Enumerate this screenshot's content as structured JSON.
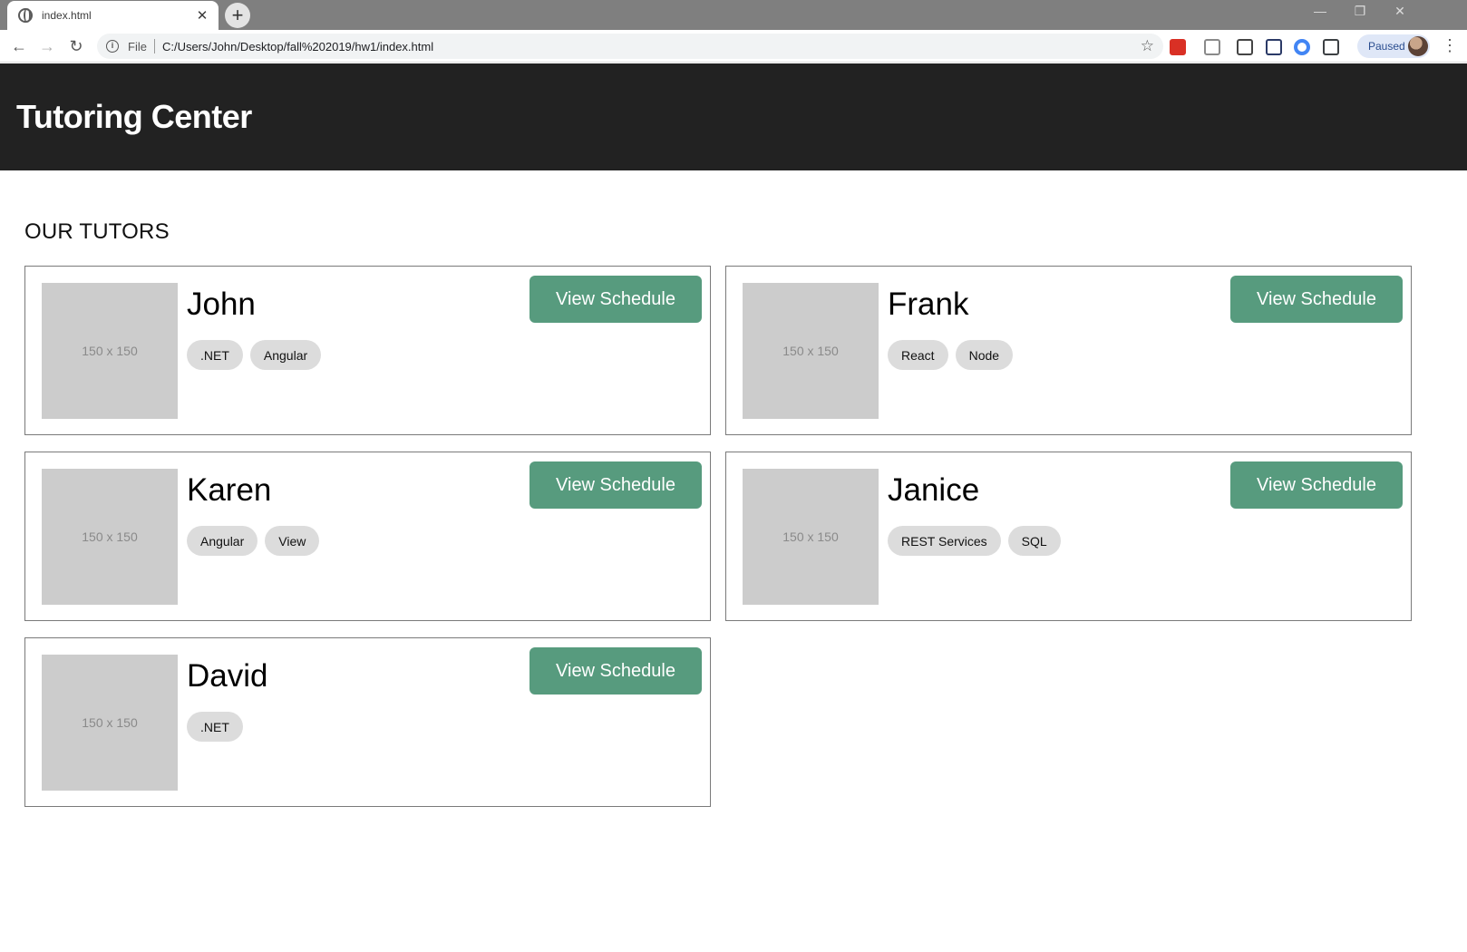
{
  "browser": {
    "tab_title": "index.html",
    "tab_close": "✕",
    "new_tab": "+",
    "window_controls": [
      "—",
      "❐",
      "✕"
    ],
    "back": "←",
    "forward": "→",
    "reload": "↻",
    "info": "i",
    "scheme": "File",
    "url": "C:/Users/John/Desktop/fall%202019/hw1/index.html",
    "star": "☆",
    "profile_status": "Paused",
    "menu": "⋮",
    "extensions": [
      {
        "name": "red-extension-icon",
        "color": "#d93025"
      },
      {
        "name": "gear-extension-icon",
        "color": "#8a8a8a"
      },
      {
        "name": "eyedropper-extension-icon",
        "color": "#444444"
      },
      {
        "name": "n-extension-icon",
        "color": "#2b3a67"
      },
      {
        "name": "colorwheel-extension-icon",
        "color": "#4285f4"
      },
      {
        "name": "capture-extension-icon",
        "color": "#3c4043"
      }
    ]
  },
  "header": {
    "title": "Tutoring Center"
  },
  "section": {
    "title": "OUR TUTORS"
  },
  "tutors": [
    {
      "name": "John",
      "photo": "150 x 150",
      "tags": [
        ".NET",
        "Angular"
      ],
      "button": "View Schedule"
    },
    {
      "name": "Frank",
      "photo": "150 x 150",
      "tags": [
        "React",
        "Node"
      ],
      "button": "View Schedule"
    },
    {
      "name": "Karen",
      "photo": "150 x 150",
      "tags": [
        "Angular",
        "View"
      ],
      "button": "View Schedule"
    },
    {
      "name": "Janice",
      "photo": "150 x 150",
      "tags": [
        "REST Services",
        "SQL"
      ],
      "button": "View Schedule"
    },
    {
      "name": "David",
      "photo": "150 x 150",
      "tags": [
        ".NET"
      ],
      "button": "View Schedule"
    }
  ],
  "colors": {
    "header_bg": "#222222",
    "button_bg": "#579b7e",
    "tag_bg": "#dcdcdc",
    "photo_bg": "#cccccc"
  }
}
